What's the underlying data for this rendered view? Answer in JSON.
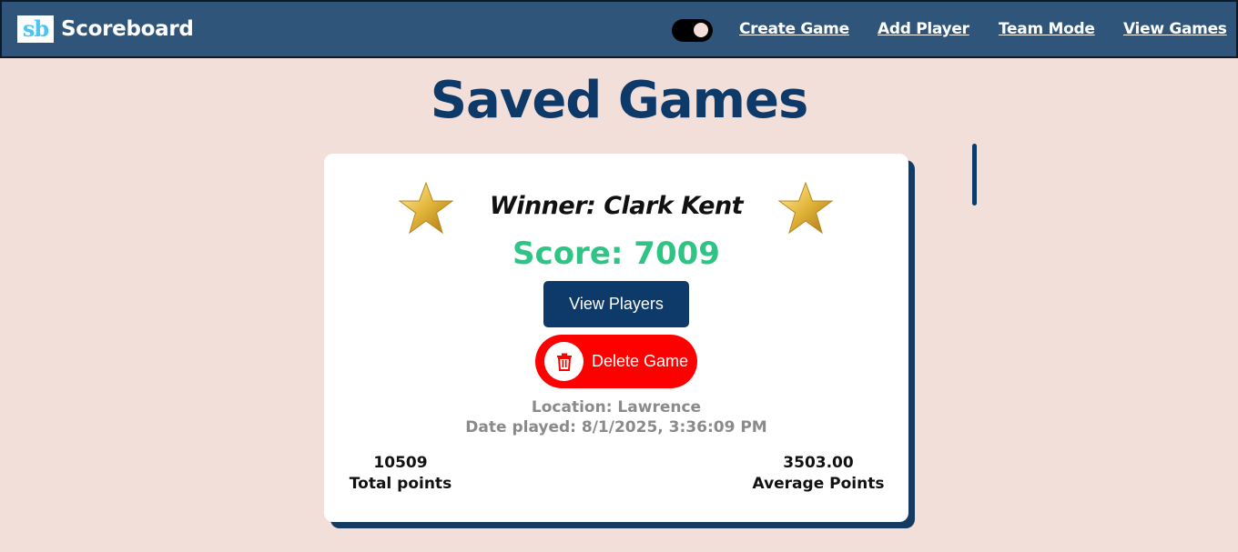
{
  "navbar": {
    "logo_text": "sb",
    "title": "Scoreboard",
    "links": [
      "Create Game",
      "Add Player",
      "Team Mode",
      "View Games"
    ]
  },
  "page": {
    "title": "Saved Games"
  },
  "game": {
    "winner": "Winner: Clark Kent",
    "score": "Score: 7009",
    "view_players_label": "View Players",
    "delete_label": "Delete Game",
    "location": "Location: Lawrence",
    "date_played": "Date played: 8/1/2025, 3:36:09 PM",
    "total_points_value": "10509",
    "total_points_label": "Total points",
    "average_points_value": "3503.00",
    "average_points_label": "Average Points"
  },
  "colors": {
    "background": "#f3dfd9",
    "navbar": "#2f557b",
    "primary": "#0d3a68",
    "score": "#2fc486",
    "danger": "#ff0000",
    "muted": "#8a8a8a"
  },
  "icons": [
    "star-icon",
    "trash-icon",
    "theme-toggle"
  ]
}
